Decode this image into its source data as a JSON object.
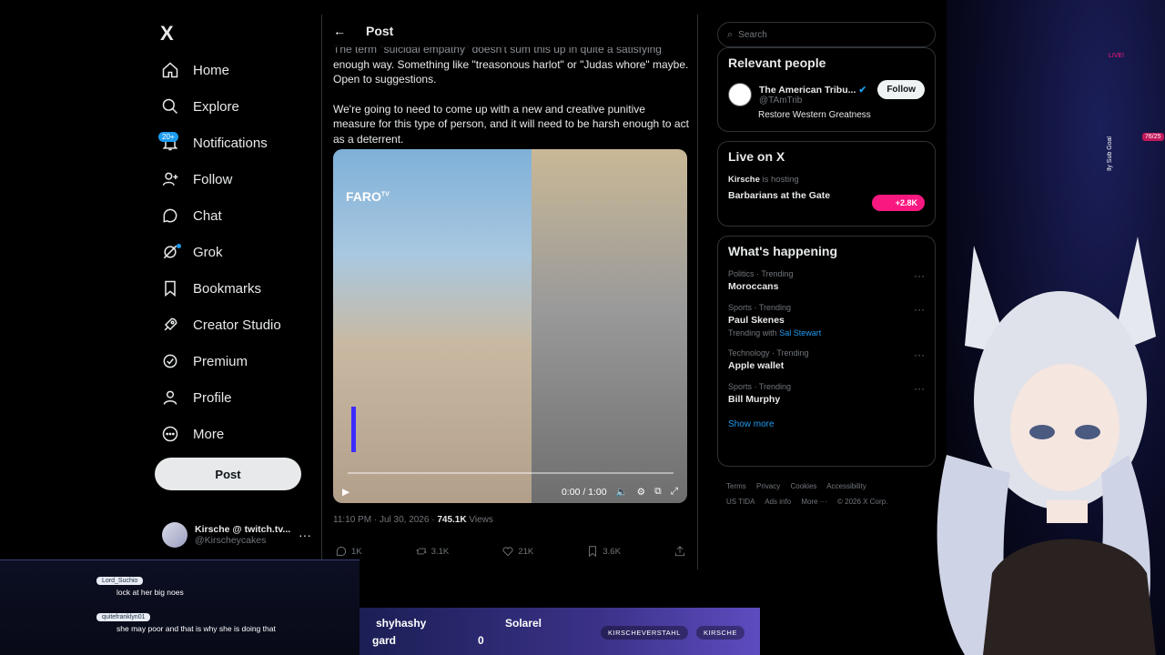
{
  "nav": {
    "logo": "X",
    "items": [
      {
        "label": "Home",
        "icon": "home-icon"
      },
      {
        "label": "Explore",
        "icon": "search-icon"
      },
      {
        "label": "Notifications",
        "icon": "bell-icon"
      },
      {
        "label": "Follow",
        "icon": "add-person-icon"
      },
      {
        "label": "Chat",
        "icon": "chat-icon"
      },
      {
        "label": "Grok",
        "icon": "grok-icon"
      },
      {
        "label": "Bookmarks",
        "icon": "bookmark-icon"
      },
      {
        "label": "Creator Studio",
        "icon": "rocket-icon"
      },
      {
        "label": "Premium",
        "icon": "verified-icon"
      },
      {
        "label": "Profile",
        "icon": "person-icon"
      },
      {
        "label": "More",
        "icon": "more-circle-icon"
      }
    ],
    "notifications_badge": "20+",
    "post_label": "Post",
    "account": {
      "name": "Kirsche @ twitch.tv...",
      "handle": "@Kirscheycakes"
    }
  },
  "post": {
    "header_title": "Post",
    "text_line0": "The term \"suicidal empathy\" doesn't sum this up in quite a satisfying",
    "text_p1": "enough way. Something like \"treasonous harlot\" or \"Judas whore\" maybe. Open to suggestions.",
    "text_p2": "We're going to need to come up with a new and creative punitive measure for this type of person, and it will need to be harsh enough to act as a deterrent.",
    "video": {
      "watermark": "FARO",
      "watermark_sub": "TV",
      "time": "0:00 / 1:00",
      "progress": 0.0
    },
    "timestamp": "11:10 PM · Jul 30, 2026 · ",
    "views_count": "745.1K",
    "views_label": " Views",
    "replies": "1K",
    "reposts": "3.1K",
    "likes": "21K",
    "bookmarks": "3.6K"
  },
  "right": {
    "search_placeholder": "Search",
    "relevant_title": "Relevant people",
    "relevant_person": {
      "name": "The American Tribu...",
      "handle": "@TAmTrib",
      "bio": "Restore Western Greatness",
      "follow_label": "Follow"
    },
    "live_title": "Live on X",
    "live_host_name": "Kirsche",
    "live_host_suffix": " is hosting",
    "live_stream_title": "Barbarians at the Gate",
    "live_count": "+2.8K",
    "happening_title": "What's happening",
    "trends": [
      {
        "category": "Politics · Trending",
        "name": "Moroccans",
        "with_prefix": "",
        "with_name": ""
      },
      {
        "category": "Sports · Trending",
        "name": "Paul Skenes",
        "with_prefix": "Trending with ",
        "with_name": "Sal Stewart"
      },
      {
        "category": "Technology · Trending",
        "name": "Apple wallet",
        "with_prefix": "",
        "with_name": ""
      },
      {
        "category": "Sports · Trending",
        "name": "Bill Murphy",
        "with_prefix": "",
        "with_name": ""
      }
    ],
    "show_more": "Show more",
    "footer": [
      "Terms",
      "Privacy",
      "Cookies",
      "Accessibility",
      "US TIDA",
      "Ads info",
      "More ···",
      "© 2026 X Corp."
    ]
  },
  "stream": {
    "chat": [
      {
        "user": "Lord_Suchio",
        "text": "lock at her big noes"
      },
      {
        "user": "quitefranklyn01",
        "text": "she may poor and that is why she is doing that"
      }
    ],
    "ticker_1": "shyhashy",
    "ticker_2": "Solarel",
    "ticker_3": "gard",
    "ticker_4": "0",
    "social_1": "KIRSCHEVERSTAHL",
    "social_2": "KIRSCHE",
    "goal_label": "lly Sub Goal",
    "goal_count": "76/25",
    "live_label": "LIVE!"
  }
}
